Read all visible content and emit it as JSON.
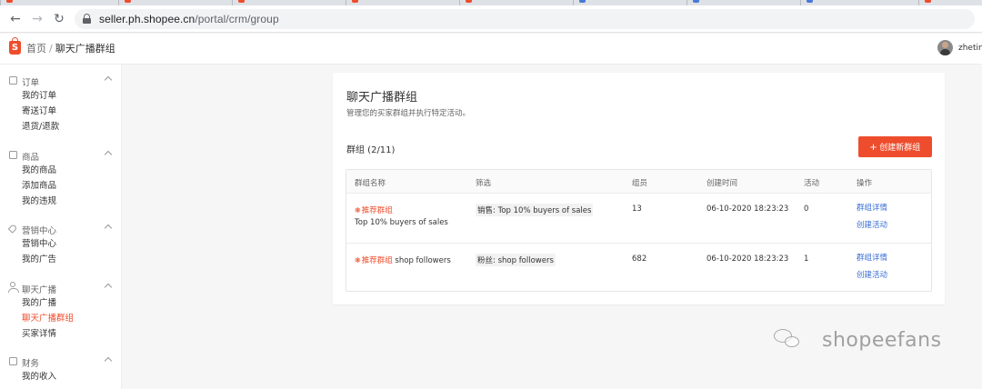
{
  "browser": {
    "url_host": "seller.ph.shopee.cn",
    "url_path": "/portal/crm/group"
  },
  "header": {
    "breadcrumb_home": "首页",
    "breadcrumb_sep": "/",
    "breadcrumb_current": "聊天广播群组",
    "username": "zhetin"
  },
  "sidebar": {
    "sections": [
      {
        "title": "订单",
        "icon": "order-icon",
        "items": [
          "我的订单",
          "寄送订单",
          "退货/退款"
        ]
      },
      {
        "title": "商品",
        "icon": "product-icon",
        "items": [
          "我的商品",
          "添加商品",
          "我的违规"
        ]
      },
      {
        "title": "营销中心",
        "icon": "tag-icon",
        "items": [
          "营销中心",
          "我的广告"
        ]
      },
      {
        "title": "聊天广播",
        "icon": "person-icon",
        "items": [
          "我的广播",
          "聊天广播群组",
          "买家详情"
        ],
        "active_index": 1
      },
      {
        "title": "财务",
        "icon": "wallet-icon",
        "items": [
          "我的收入"
        ]
      }
    ]
  },
  "main": {
    "title": "聊天广播群组",
    "subtitle": "管理您的买家群组并执行特定活动。",
    "group_count": "群组 (2/11)",
    "create_button": "创建新群组",
    "table": {
      "headers": [
        "群组名称",
        "筛选",
        "组员",
        "创建时间",
        "活动",
        "操作"
      ],
      "rows": [
        {
          "tag": "推荐群组",
          "name": "Top 10% buyers of sales",
          "filter_label": "销售:",
          "filter_value": "Top 10% buyers of sales",
          "members": "13",
          "created": "06-10-2020 18:23:23",
          "activities": "0",
          "action_detail": "群组详情",
          "action_create": "创建活动"
        },
        {
          "tag": "推荐群组",
          "name": "shop followers",
          "filter_label": "粉丝:",
          "filter_value": "shop followers",
          "members": "682",
          "created": "06-10-2020 18:23:23",
          "activities": "1",
          "action_detail": "群组详情",
          "action_create": "创建活动"
        }
      ]
    }
  },
  "watermark": "shopeefans",
  "colors": {
    "brand": "#ee4d2d",
    "link": "#3b6fd6"
  }
}
